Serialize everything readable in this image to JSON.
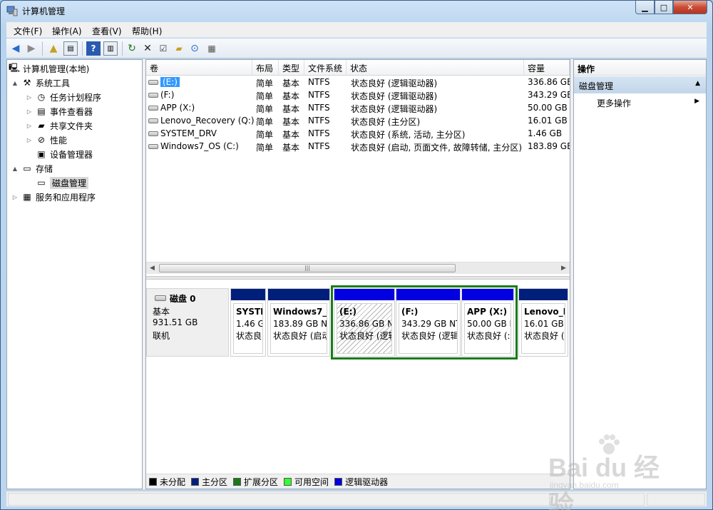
{
  "window": {
    "title": "计算机管理"
  },
  "menu": [
    "文件(F)",
    "操作(A)",
    "查看(V)",
    "帮助(H)"
  ],
  "tree": [
    {
      "label": "计算机管理(本地)",
      "icon": "computer-icon",
      "level": 0,
      "exp": ""
    },
    {
      "label": "系统工具",
      "icon": "tools-icon",
      "level": 1,
      "exp": "▲"
    },
    {
      "label": "任务计划程序",
      "icon": "clock-icon",
      "level": 2,
      "exp": "▷"
    },
    {
      "label": "事件查看器",
      "icon": "event-viewer-icon",
      "level": 2,
      "exp": "▷"
    },
    {
      "label": "共享文件夹",
      "icon": "shared-folder-icon",
      "level": 2,
      "exp": "▷"
    },
    {
      "label": "性能",
      "icon": "performance-icon",
      "level": 2,
      "exp": "▷"
    },
    {
      "label": "设备管理器",
      "icon": "device-manager-icon",
      "level": 2,
      "exp": ""
    },
    {
      "label": "存储",
      "icon": "storage-icon",
      "level": 1,
      "exp": "▲"
    },
    {
      "label": "磁盘管理",
      "icon": "disk-management-icon",
      "level": 2,
      "exp": "",
      "selected": true
    },
    {
      "label": "服务和应用程序",
      "icon": "services-icon",
      "level": 1,
      "exp": "▷"
    }
  ],
  "volumes": {
    "columns": [
      "卷",
      "布局",
      "类型",
      "文件系统",
      "状态",
      "容量"
    ],
    "rows": [
      [
        "(E:)",
        "简单",
        "基本",
        "NTFS",
        "状态良好 (逻辑驱动器)",
        "336.86 GB"
      ],
      [
        "(F:)",
        "简单",
        "基本",
        "NTFS",
        "状态良好 (逻辑驱动器)",
        "343.29 GB"
      ],
      [
        "APP (X:)",
        "简单",
        "基本",
        "NTFS",
        "状态良好 (逻辑驱动器)",
        "50.00 GB"
      ],
      [
        "Lenovo_Recovery (Q:)",
        "简单",
        "基本",
        "NTFS",
        "状态良好 (主分区)",
        "16.01 GB"
      ],
      [
        "SYSTEM_DRV",
        "简单",
        "基本",
        "NTFS",
        "状态良好 (系统, 活动, 主分区)",
        "1.46 GB"
      ],
      [
        "Windows7_OS (C:)",
        "简单",
        "基本",
        "NTFS",
        "状态良好 (启动, 页面文件, 故障转储, 主分区)",
        "183.89 GB"
      ]
    ]
  },
  "disk": {
    "name": "磁盘 0",
    "type": "基本",
    "size": "931.51 GB",
    "status": "联机"
  },
  "partitions": [
    {
      "name": "SYSTE",
      "size": "1.46 G",
      "status": "状态良",
      "color": "#001f7a"
    },
    {
      "name": "Windows7_(",
      "size": "183.89 GB N",
      "status": "状态良好 (启动",
      "color": "#001f7a"
    },
    {
      "name": "(E:)",
      "size": "336.86 GB N",
      "status": "状态良好 (逻辑",
      "color": "#0000e0",
      "hatched": true
    },
    {
      "name": "(F:)",
      "size": "343.29 GB NT",
      "status": "状态良好 (逻辑",
      "color": "#0000e0"
    },
    {
      "name": "APP  (X:)",
      "size": "50.00 GB I",
      "status": "状态良好 (:",
      "color": "#0000e0"
    },
    {
      "name": "Lenovo_F",
      "size": "16.01 GB",
      "status": "状态良好 (",
      "color": "#001f7a"
    }
  ],
  "legend": [
    {
      "label": "未分配",
      "color": "#000000"
    },
    {
      "label": "主分区",
      "color": "#001f7a"
    },
    {
      "label": "扩展分区",
      "color": "#1a7a1a"
    },
    {
      "label": "可用空间",
      "color": "#33ff33"
    },
    {
      "label": "逻辑驱动器",
      "color": "#0000e0"
    }
  ],
  "actions": {
    "header": "操作",
    "section": "磁盘管理",
    "item": "更多操作"
  },
  "watermark": {
    "main": "Bai du 经验",
    "sub": "jingyan.baidu.com"
  }
}
